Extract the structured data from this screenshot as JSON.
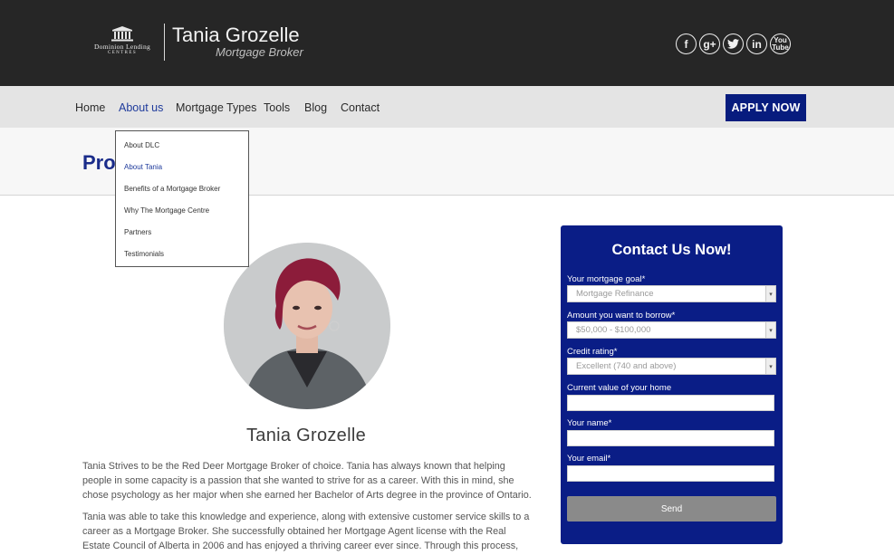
{
  "header": {
    "dlc_logo_name": "Dominion Lending",
    "dlc_logo_sub": "CENTRES",
    "brand_name": "Tania Grozelle",
    "brand_title": "Mortgage Broker",
    "social": [
      {
        "name": "facebook-icon",
        "glyph": "f"
      },
      {
        "name": "google-plus-icon",
        "glyph": "g+"
      },
      {
        "name": "twitter-icon",
        "glyph": "t"
      },
      {
        "name": "linkedin-icon",
        "glyph": "in"
      },
      {
        "name": "youtube-icon",
        "glyph": "You Tube"
      }
    ]
  },
  "nav": {
    "items": [
      "Home",
      "About us",
      "Mortgage Types",
      "Tools",
      "Blog",
      "Contact"
    ],
    "active": "About us",
    "apply_label": "APPLY NOW"
  },
  "dropdown": {
    "items": [
      "About DLC",
      "About Tania",
      "Benefits of a Mortgage Broker",
      "Why The Mortgage Centre",
      "Partners",
      "Testimonials"
    ],
    "active": "About Tania"
  },
  "page": {
    "title": "Pro"
  },
  "profile": {
    "name": "Tania Grozelle",
    "bio": [
      "Tania Strives to be the Red Deer Mortgage Broker of choice. Tania has always known that helping people in some capacity is a passion that she wanted to strive for as a career. With this in mind, she chose psychology as her major when she earned her Bachelor of Arts degree in the province of Ontario.",
      "Tania was able to take this knowledge and experience, along with extensive customer service skills to a career as a Mortgage Broker. She successfully obtained her Mortgage Agent license with the Real Estate Council of Alberta in 2006 and has enjoyed a thriving career ever since. Through this process, Tania realized very quickly that real estate and personal finance was where her true calling lies. Taking the"
    ]
  },
  "contact": {
    "title": "Contact Us Now!",
    "goal_label": "Your mortgage goal*",
    "goal_value": "Mortgage Refinance",
    "amount_label": "Amount you want to borrow*",
    "amount_value": "$50,000 - $100,000",
    "credit_label": "Credit rating*",
    "credit_value": "Excellent (740 and above)",
    "home_value_label": "Current value of your home",
    "name_label": "Your name*",
    "email_label": "Your email*",
    "send_label": "Send"
  },
  "colors": {
    "header_bg": "#262626",
    "nav_bg": "#e4e4e4",
    "accent_navy": "#071c7e",
    "active_link": "#1f3b9c",
    "send_button": "#8a8a8a"
  }
}
